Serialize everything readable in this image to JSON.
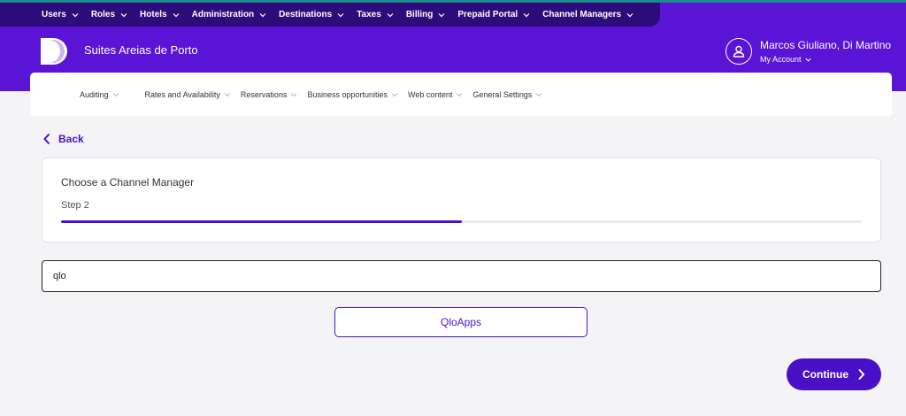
{
  "top_nav": [
    {
      "label": "Users"
    },
    {
      "label": "Roles"
    },
    {
      "label": "Hotels"
    },
    {
      "label": "Administration"
    },
    {
      "label": "Destinations"
    },
    {
      "label": "Taxes"
    },
    {
      "label": "Billing"
    },
    {
      "label": "Prepaid Portal"
    },
    {
      "label": "Channel Managers"
    }
  ],
  "header": {
    "hotel_name": "Suites Areias de Porto",
    "account_name": "Marcos Giuliano, Di Martino",
    "account_label": "My Account"
  },
  "sub_nav": [
    {
      "label": "Auditing"
    },
    {
      "label": "Rates and Availability"
    },
    {
      "label": "Reservations"
    },
    {
      "label": "Business opportunities"
    },
    {
      "label": "Web content"
    },
    {
      "label": "General Settings"
    }
  ],
  "back_label": "Back",
  "wizard": {
    "title": "Choose a Channel Manager",
    "step": "Step 2",
    "progress_percent": 50
  },
  "search": {
    "value": "qlo"
  },
  "result_label": "QloApps",
  "continue_label": "Continue",
  "colors": {
    "header": "#5a14d6",
    "top_nav": "#2d0b7a",
    "accent": "#4a10c6"
  }
}
